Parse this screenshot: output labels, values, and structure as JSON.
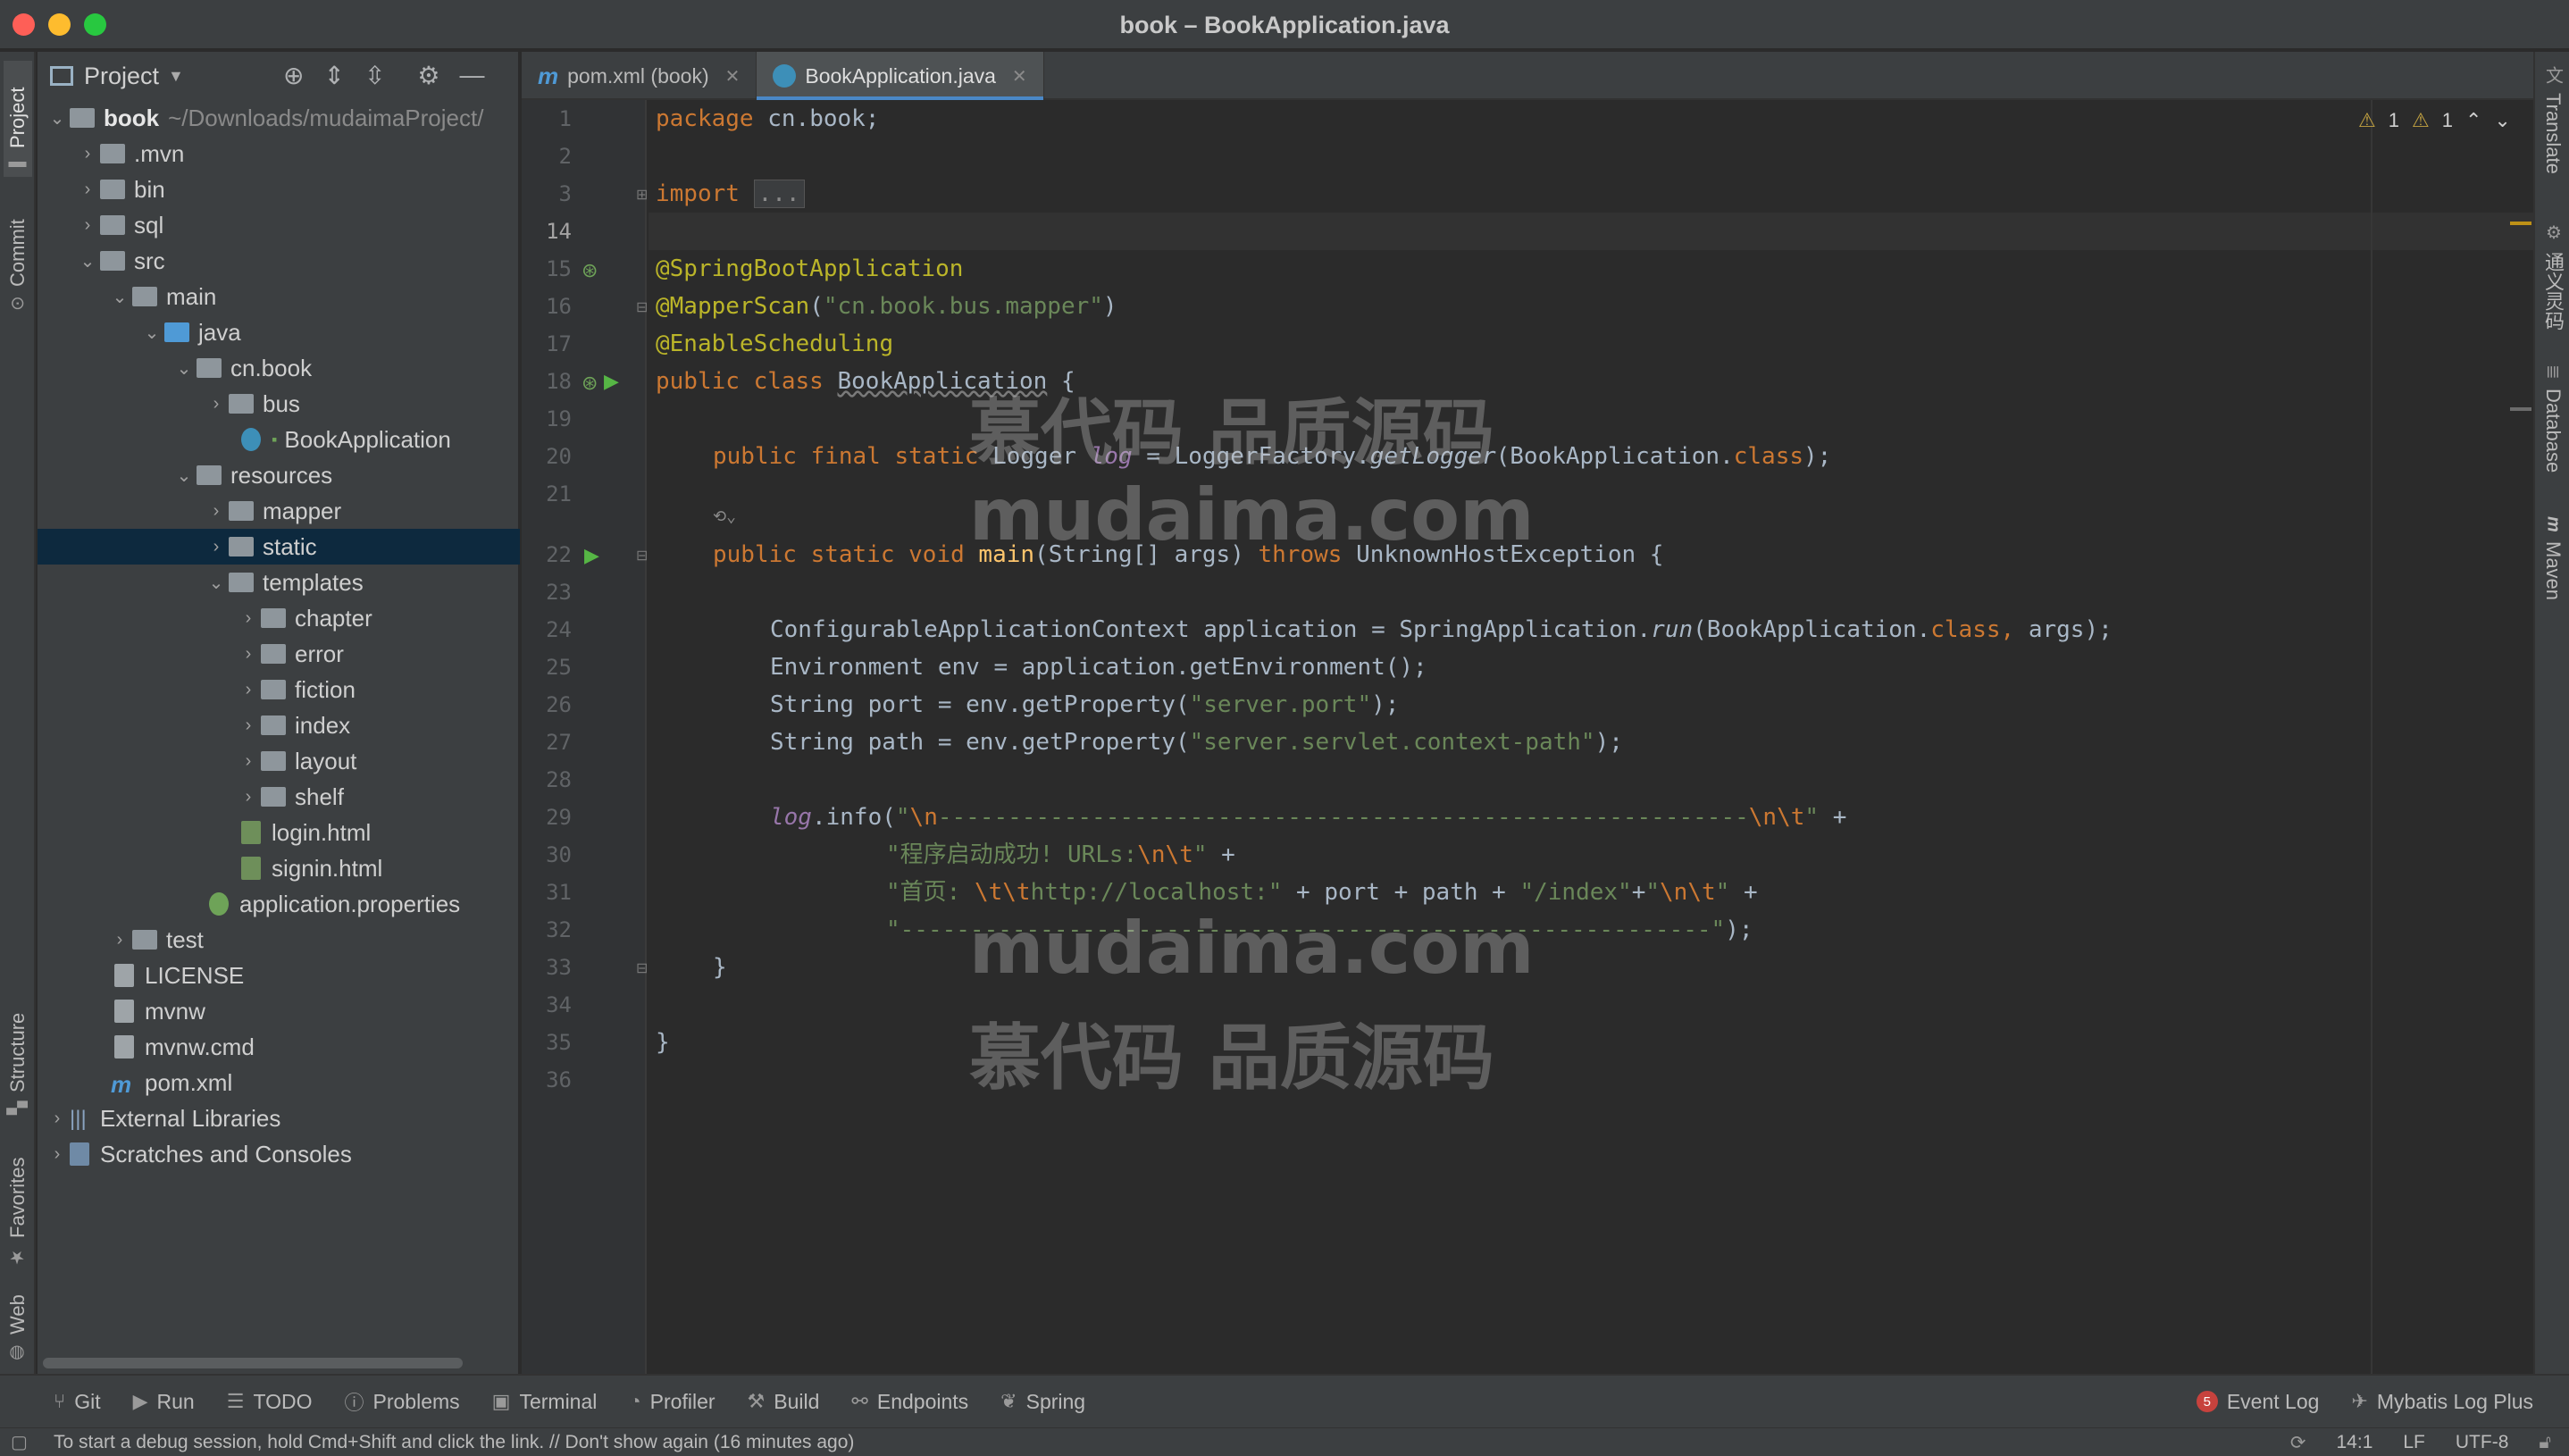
{
  "window": {
    "title": "book – BookApplication.java"
  },
  "left_strip": [
    "Project",
    "Commit",
    "Structure",
    "Favorites",
    "Web"
  ],
  "right_strip": [
    "Translate",
    "通义灵码",
    "Database",
    "Maven"
  ],
  "project": {
    "header": "Project",
    "tree": [
      {
        "label": "book",
        "hint": "~/Downloads/mudaimaProject/"
      },
      {
        "label": ".mvn"
      },
      {
        "label": "bin"
      },
      {
        "label": "sql"
      },
      {
        "label": "src"
      },
      {
        "label": "main"
      },
      {
        "label": "java"
      },
      {
        "label": "cn.book"
      },
      {
        "label": "bus"
      },
      {
        "label": "BookApplication"
      },
      {
        "label": "resources"
      },
      {
        "label": "mapper"
      },
      {
        "label": "static"
      },
      {
        "label": "templates"
      },
      {
        "label": "chapter"
      },
      {
        "label": "error"
      },
      {
        "label": "fiction"
      },
      {
        "label": "index"
      },
      {
        "label": "layout"
      },
      {
        "label": "shelf"
      },
      {
        "label": "login.html"
      },
      {
        "label": "signin.html"
      },
      {
        "label": "application.properties"
      },
      {
        "label": "test"
      },
      {
        "label": "LICENSE"
      },
      {
        "label": "mvnw"
      },
      {
        "label": "mvnw.cmd"
      },
      {
        "label": "pom.xml"
      },
      {
        "label": "External Libraries"
      },
      {
        "label": "Scratches and Consoles"
      }
    ]
  },
  "tabs": [
    {
      "label": "pom.xml (book)"
    },
    {
      "label": "BookApplication.java"
    }
  ],
  "gutter": {
    "line_numbers": [
      "1",
      "2",
      "3",
      "14",
      "15",
      "16",
      "17",
      "18",
      "19",
      "20",
      "21",
      "22",
      "23",
      "24",
      "25",
      "26",
      "27",
      "28",
      "29",
      "30",
      "31",
      "32",
      "33",
      "34",
      "35",
      "36"
    ]
  },
  "code": {
    "l1_kw": "package",
    "l1_rest": " cn.book;",
    "l3_kw": "import",
    "l3_fold": "...",
    "l15": "@SpringBootApplication",
    "l16_an": "@MapperScan",
    "l16_p1": "(",
    "l16_str": "\"cn.book.bus.mapper\"",
    "l16_p2": ")",
    "l17": "@EnableScheduling",
    "l18_kw": "public class ",
    "l18_name": "BookApplication",
    "l18_rest": " {",
    "l20_kw": "public final static ",
    "l20_t": "Logger ",
    "l20_f": "log",
    "l20_eq": " = LoggerFactory.",
    "l20_m": "getLogger",
    "l20_a": "(BookApplication.",
    "l20_cls": "class",
    "l20_end": ");",
    "l22_kw": "public static void ",
    "l22_fn": "main",
    "l22_args": "(String[] args) ",
    "l22_kw2": "throws",
    "l22_rest": " UnknownHostException {",
    "l24_a": "ConfigurableApplicationContext application = SpringApplication.",
    "l24_m": "run",
    "l24_b": "(BookApplication.",
    "l24_cls": "class, ",
    "l24_c": "args);",
    "l25": "Environment env = application.getEnvironment();",
    "l26_a": "String port = env.getProperty(",
    "l26_s": "\"server.port\"",
    "l26_b": ");",
    "l27_a": "String path = env.getProperty(",
    "l27_s": "\"server.servlet.context-path\"",
    "l27_b": ");",
    "l29_f": "log",
    "l29_a": ".info(",
    "l29_s1": "\"",
    "l29_e1": "\\n",
    "l29_s2": "----------------------------------------------------------",
    "l29_e2": "\\n\\t",
    "l29_s3": "\"",
    "l29_b": " +",
    "l30_s1": "\"程序启动成功! URLs:",
    "l30_e": "\\n\\t",
    "l30_s2": "\"",
    "l30_b": " +",
    "l31_s1": "\"首页: ",
    "l31_e": "\\t\\t",
    "l31_s2": "http://localhost:\"",
    "l31_b": " + port + path + ",
    "l31_s3": "\"/index\"",
    "l31_c": "+",
    "l31_s4": "\"",
    "l31_e2": "\\n\\t",
    "l31_s5": "\"",
    "l31_d": " +",
    "l32_s": "\"----------------------------------------------------------\"",
    "l32_b": ");",
    "l33": "}",
    "l35": "}"
  },
  "inspections": {
    "warn1": "1",
    "warn2": "1"
  },
  "watermark": {
    "a": "慕代码 品质源码",
    "b": "mudaima.com",
    "c": "mudaima.com",
    "d": "慕代码 品质源码"
  },
  "bottom_tools": {
    "git": "Git",
    "run": "Run",
    "todo": "TODO",
    "problems": "Problems",
    "terminal": "Terminal",
    "profiler": "Profiler",
    "build": "Build",
    "endpoints": "Endpoints",
    "spring": "Spring",
    "event_count": "5",
    "event_log": "Event Log",
    "mybatis": "Mybatis Log Plus"
  },
  "status": {
    "message": "To start a debug session, hold Cmd+Shift and click the link. // Don't show again (16 minutes ago)",
    "position": "14:1",
    "line_sep": "LF",
    "encoding": "UTF-8"
  },
  "colors": {
    "accent": "#4a88c7",
    "selection": "#0d293e",
    "keyword": "#cc7832",
    "annotation": "#bbb529",
    "string": "#6a8759"
  }
}
